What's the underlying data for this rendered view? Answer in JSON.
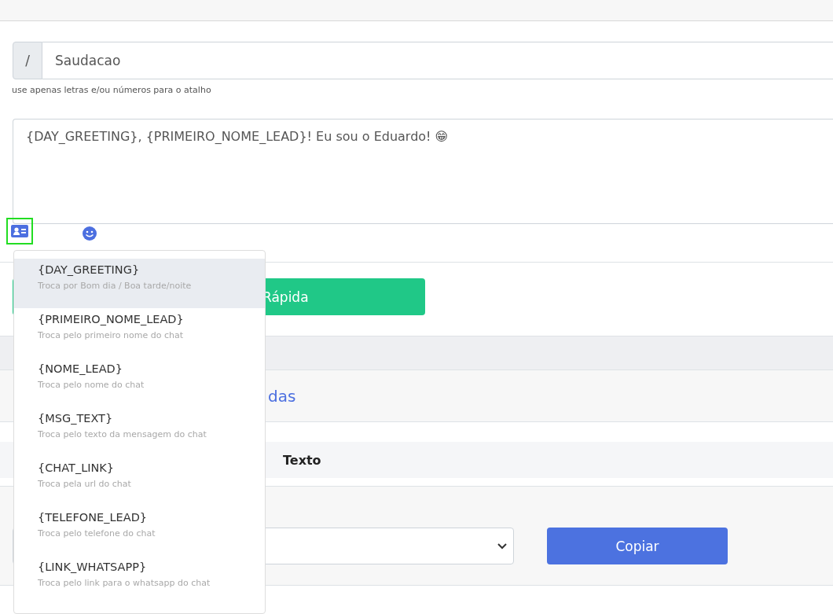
{
  "shortcut": {
    "prefix": "/",
    "value": "Saudacao",
    "hint": "use apenas letras e/ou números para o atalho"
  },
  "message": {
    "value": "{DAY_GREETING}, {PRIMEIRO_NOME_LEAD}! Eu sou o Eduardo! 😁"
  },
  "toolbar": {
    "variables_active": true
  },
  "save_button": {
    "label": "Rápida"
  },
  "section": {
    "title": "das"
  },
  "table": {
    "columns": [
      "Texto"
    ]
  },
  "copy": {
    "button": "Copiar"
  },
  "variables_menu": {
    "items": [
      {
        "token": "{DAY_GREETING}",
        "description": "Troca por Bom dia / Boa tarde/noite",
        "selected": true
      },
      {
        "token": "{PRIMEIRO_NOME_LEAD}",
        "description": "Troca pelo primeiro nome do chat",
        "selected": false
      },
      {
        "token": "{NOME_LEAD}",
        "description": "Troca pelo nome do chat",
        "selected": false
      },
      {
        "token": "{MSG_TEXT}",
        "description": "Troca pelo texto da mensagem do chat",
        "selected": false
      },
      {
        "token": "{CHAT_LINK}",
        "description": "Troca pela url do chat",
        "selected": false
      },
      {
        "token": "{TELEFONE_LEAD}",
        "description": "Troca pelo telefone do chat",
        "selected": false
      },
      {
        "token": "{LINK_WHATSAPP}",
        "description": "Troca pelo link para o whatsapp do chat",
        "selected": false
      }
    ]
  }
}
